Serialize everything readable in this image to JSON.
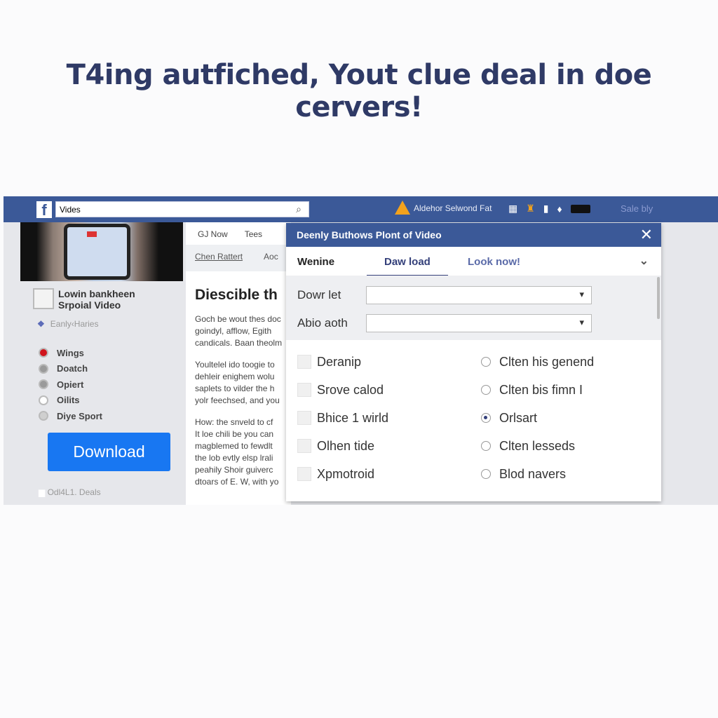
{
  "headline": "T4ing autfiched, Yout clue deal in doe cervers!",
  "nav": {
    "search_value": "Vides",
    "notice": "Aldehor Selwond Fat",
    "account": "Sale bly"
  },
  "left": {
    "channel_line1": "Lowin bankheen",
    "channel_line2": "Srpoial Video",
    "early": "Eanly‹Haries",
    "options": [
      {
        "label": "Wings",
        "color": "#d0141c"
      },
      {
        "label": "Doatch",
        "color": "#9a9a9a"
      },
      {
        "label": "Opiert",
        "color": "#9a9a9a"
      },
      {
        "label": "Oilits",
        "color": "#ffffff"
      },
      {
        "label": "Diye Sport",
        "color": "#cfcfcf"
      }
    ],
    "download": "Download",
    "footer": "Odl4L1. Deals"
  },
  "mid": {
    "tabs": [
      "GJ Now",
      "Tees"
    ],
    "subtabs": [
      "Chen Rattert",
      "Aoc"
    ],
    "heading": "Diescible th",
    "paragraphs": [
      [
        "Goch be wout thes doc",
        "goindyl,  afflow, Egith",
        "candicals. Baan theolm"
      ],
      [
        "Youltelel ido toogie to",
        "dehleir enighem wolu",
        "saplets to vilder the h",
        "yolr feechsed, and you"
      ],
      [
        "How: the snveld to cf",
        "It loe chili be you can",
        "magblemed to fewdlt",
        "the lob evtly elsp lrali",
        "peahily Shoir guiverc",
        "dtoars of E. W, with yo"
      ]
    ]
  },
  "modal": {
    "title": "Deenly Buthows Plont of Video",
    "tabs": [
      "Wenine",
      "Daw load",
      "Look now!"
    ],
    "active_tab": "Daw load",
    "fields": [
      {
        "label": "Dowr let",
        "value": ""
      },
      {
        "label": "Abio aoth",
        "value": ""
      }
    ],
    "checkboxes": [
      "Deranip",
      "Srove calod",
      "Bhice 1 wirld",
      "Olhen tide",
      "Xpmotroid"
    ],
    "radios": [
      {
        "label": "Clten his genend",
        "selected": false
      },
      {
        "label": "Clten bis fimn I",
        "selected": false
      },
      {
        "label": "Orlsart",
        "selected": true
      },
      {
        "label": "Clten lesseds",
        "selected": false
      },
      {
        "label": "Blod navers",
        "selected": false
      }
    ]
  },
  "colors": {
    "nav": "#3b5998",
    "button": "#1877f2",
    "headline": "#2f3a66"
  }
}
